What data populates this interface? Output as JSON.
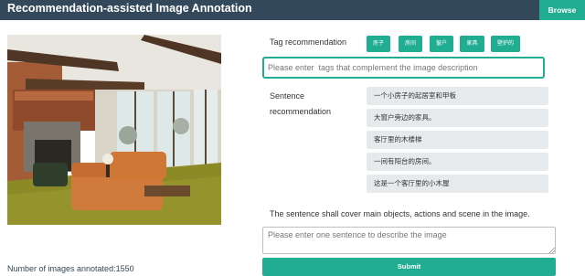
{
  "header": {
    "title": "Recommendation-assisted Image Annotation",
    "browse_label": "Browse",
    "bg_color": "#34485c",
    "accent_color": "#20ad92"
  },
  "left": {
    "images_annotated_label": "Number of images annotated:1550"
  },
  "tags": {
    "label": "Tag recommendation",
    "items": [
      "房子",
      "房间",
      "窗户",
      "家具",
      "壁炉的"
    ],
    "input_placeholder": "Please enter  tags that complement the image description",
    "input_value": ""
  },
  "sentences": {
    "label": "Sentence recommendation",
    "items": [
      "一个小房子的起居室和甲板",
      "大窗户旁边的家具。",
      "客厅里的木楼梯",
      "一间有阳台的房间。",
      "这是一个客厅里的小木屋"
    ]
  },
  "guideline": "The sentence shall cover main objects, actions and scene in the image.",
  "sentence_input": {
    "placeholder": "Please enter one sentence to describe the image",
    "value": ""
  },
  "submit_label": "Submit"
}
